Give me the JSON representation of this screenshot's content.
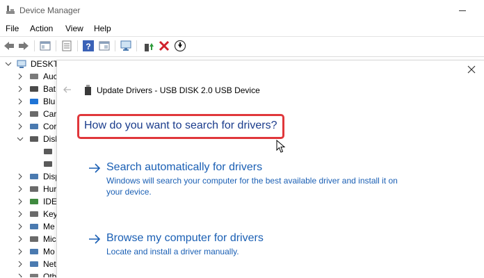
{
  "window": {
    "title": "Device Manager",
    "icon": "device-manager-icon"
  },
  "menu": {
    "items": [
      "File",
      "Action",
      "View",
      "Help"
    ]
  },
  "toolbar": {
    "buttons": [
      "back-arrow-icon",
      "forward-arrow-icon",
      "properties-icon",
      "list-icon",
      "help-icon",
      "view-icon",
      "monitor-icon",
      "update-driver-icon",
      "uninstall-icon",
      "download-icon"
    ]
  },
  "tree": {
    "root": "DESKTO",
    "items": [
      {
        "label": "Auc",
        "icon": "audio-icon",
        "expanded": false
      },
      {
        "label": "Bat",
        "icon": "battery-icon",
        "expanded": false
      },
      {
        "label": "Blu",
        "icon": "bluetooth-icon",
        "expanded": false
      },
      {
        "label": "Car",
        "icon": "camera-icon",
        "expanded": false
      },
      {
        "label": "Cor",
        "icon": "computer-icon",
        "expanded": false
      },
      {
        "label": "Disl",
        "icon": "disk-icon",
        "expanded": true
      },
      {
        "label": "",
        "icon": "disk-drive-icon",
        "child": true
      },
      {
        "label": "",
        "icon": "disk-drive-icon",
        "child": true
      },
      {
        "label": "Disp",
        "icon": "display-icon",
        "expanded": false
      },
      {
        "label": "Hur",
        "icon": "hid-icon",
        "expanded": false
      },
      {
        "label": "IDE",
        "icon": "ide-icon",
        "expanded": false
      },
      {
        "label": "Key",
        "icon": "keyboard-icon",
        "expanded": false
      },
      {
        "label": "Me",
        "icon": "memory-icon",
        "expanded": false
      },
      {
        "label": "Mic",
        "icon": "mouse-icon",
        "expanded": false
      },
      {
        "label": "Mo",
        "icon": "monitor-icon",
        "expanded": false
      },
      {
        "label": "Net",
        "icon": "network-icon",
        "expanded": false
      },
      {
        "label": "Oth",
        "icon": "other-icon",
        "expanded": false
      }
    ]
  },
  "dialog": {
    "title": "Update Drivers - USB DISK 2.0 USB Device",
    "question": "How do you want to search for drivers?",
    "options": [
      {
        "title": "Search automatically for drivers",
        "description": "Windows will search your computer for the best available driver and install it on your device."
      },
      {
        "title": "Browse my computer for drivers",
        "description": "Locate and install a driver manually."
      }
    ],
    "highlight_color": "#e0373b",
    "link_color": "#1a5fb4"
  }
}
